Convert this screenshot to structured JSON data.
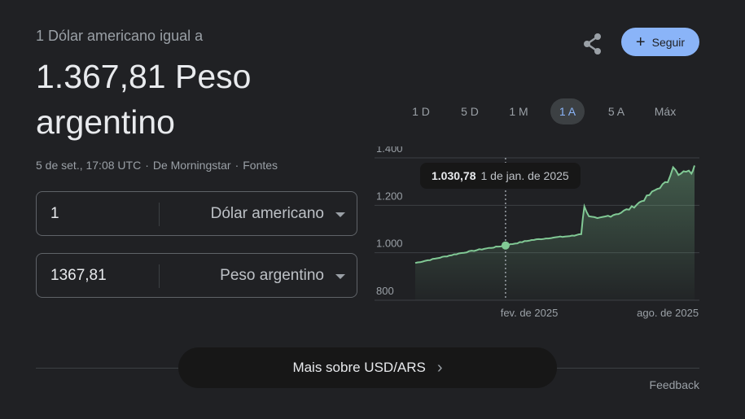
{
  "header": {
    "subtitle": "1 Dólar americano igual a",
    "amount": "1.367,81 Peso argentino",
    "timestamp": "5 de set., 17:08 UTC",
    "source": "De Morningstar",
    "sources_link": "Fontes"
  },
  "actions": {
    "share_icon": "share-icon",
    "follow_label": "Seguir",
    "follow_icon": "plus-icon"
  },
  "converter": {
    "from": {
      "value": "1",
      "currency": "Dólar americano"
    },
    "to": {
      "value": "1367,81",
      "currency": "Peso argentino"
    }
  },
  "ranges": [
    "1 D",
    "5 D",
    "1 M",
    "1 A",
    "5 A",
    "Máx"
  ],
  "active_range": "1 A",
  "tooltip": {
    "value": "1.030,78",
    "date": "1 de jan. de 2025"
  },
  "chart_data": {
    "type": "area",
    "y_ticks": [
      "1.400",
      "1.200",
      "1.000",
      "800"
    ],
    "ylim": [
      800,
      1400
    ],
    "x_ticks": [
      "fev. de 2025",
      "ago. de 2025"
    ],
    "color": "#81c995",
    "points": [
      [
        "2024-09-05",
        957
      ],
      [
        "2024-10-01",
        975
      ],
      [
        "2024-11-01",
        997
      ],
      [
        "2024-12-01",
        1015
      ],
      [
        "2025-01-01",
        1030.78
      ],
      [
        "2025-02-01",
        1052
      ],
      [
        "2025-03-01",
        1063
      ],
      [
        "2025-04-01",
        1072
      ],
      [
        "2025-04-10",
        1082
      ],
      [
        "2025-04-14",
        1200
      ],
      [
        "2025-04-20",
        1150
      ],
      [
        "2025-05-01",
        1140
      ],
      [
        "2025-05-15",
        1155
      ],
      [
        "2025-06-01",
        1170
      ],
      [
        "2025-06-15",
        1190
      ],
      [
        "2025-07-01",
        1225
      ],
      [
        "2025-07-15",
        1262
      ],
      [
        "2025-08-01",
        1300
      ],
      [
        "2025-08-08",
        1365
      ],
      [
        "2025-08-15",
        1325
      ],
      [
        "2025-08-25",
        1345
      ],
      [
        "2025-09-01",
        1338
      ],
      [
        "2025-09-05",
        1367.81
      ]
    ],
    "marker_date": "2025-01-01"
  },
  "footer": {
    "more_label": "Mais sobre USD/ARS",
    "feedback": "Feedback"
  }
}
